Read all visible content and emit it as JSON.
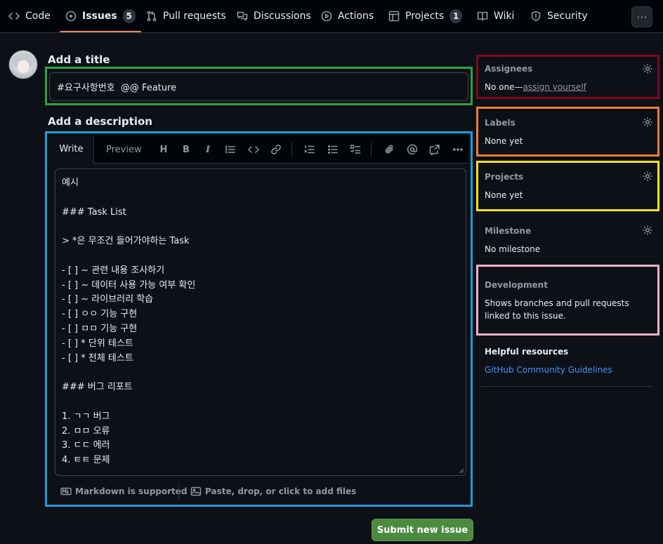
{
  "nav": {
    "tabs": [
      {
        "label": "Code",
        "icon": "code-icon"
      },
      {
        "label": "Issues",
        "icon": "issue-opened-icon",
        "count": "5"
      },
      {
        "label": "Pull requests",
        "icon": "git-pull-request-icon"
      },
      {
        "label": "Discussions",
        "icon": "comment-discussion-icon"
      },
      {
        "label": "Actions",
        "icon": "play-icon"
      },
      {
        "label": "Projects",
        "icon": "table-icon",
        "count": "1"
      },
      {
        "label": "Wiki",
        "icon": "book-icon"
      },
      {
        "label": "Security",
        "icon": "shield-icon"
      }
    ],
    "more_label": "···"
  },
  "form": {
    "title_label": "Add a title",
    "title_value": "#요구사항번호  @@ Feature",
    "description_label": "Add a description",
    "write_tab": "Write",
    "preview_tab": "Preview",
    "toolbar": {
      "heading": "H",
      "bold": "B",
      "italic": "I"
    },
    "body_lines": [
      "예시",
      "",
      "### Task List",
      "",
      "> *은 무조건 들어가야하는 Task",
      "",
      "- [ ] ~ 관련 내용 조사하기",
      "- [ ] ~ 데이터 사용 가능 여부 확인",
      "- [ ] ~ 라이브러리 학습",
      "- [ ] ㅇㅇ 기능 구현",
      "- [ ] ㅁㅁ 기능 구현",
      "- [ ] * 단위 테스트",
      "- [ ] * 전체 테스트",
      "",
      "### 버그 리포트",
      "",
      "1. ㄱㄱ 버그",
      "2. ㅁㅁ 오류",
      "3. ㄷㄷ 에러",
      "4. ㅌㅌ 문제"
    ],
    "markdown_note": "Markdown is supported",
    "attach_note": "Paste, drop, or click to add files",
    "submit_label": "Submit new issue"
  },
  "sidebar": {
    "assignees": {
      "title": "Assignees",
      "value_prefix": "No one—",
      "value_link": "assign yourself"
    },
    "labels": {
      "title": "Labels",
      "value": "None yet"
    },
    "projects": {
      "title": "Projects",
      "value": "None yet"
    },
    "milestone": {
      "title": "Milestone",
      "value": "No milestone"
    },
    "development": {
      "title": "Development",
      "value": "Shows branches and pull requests linked to this issue."
    },
    "helpful": {
      "title": "Helpful resources",
      "link": "GitHub Community Guidelines"
    }
  },
  "colors": {
    "background": "#0d1117",
    "accent_underline": "#f78166",
    "submit_green": "#4c8b3f",
    "link_blue": "#4493f8",
    "annotation_green": "#2ea043",
    "annotation_blue": "#1f9bd9",
    "annotation_red": "#7d0b1c",
    "annotation_orange": "#f07d30",
    "annotation_yellow": "#f6e11a",
    "annotation_pink": "#f6b0c4"
  }
}
